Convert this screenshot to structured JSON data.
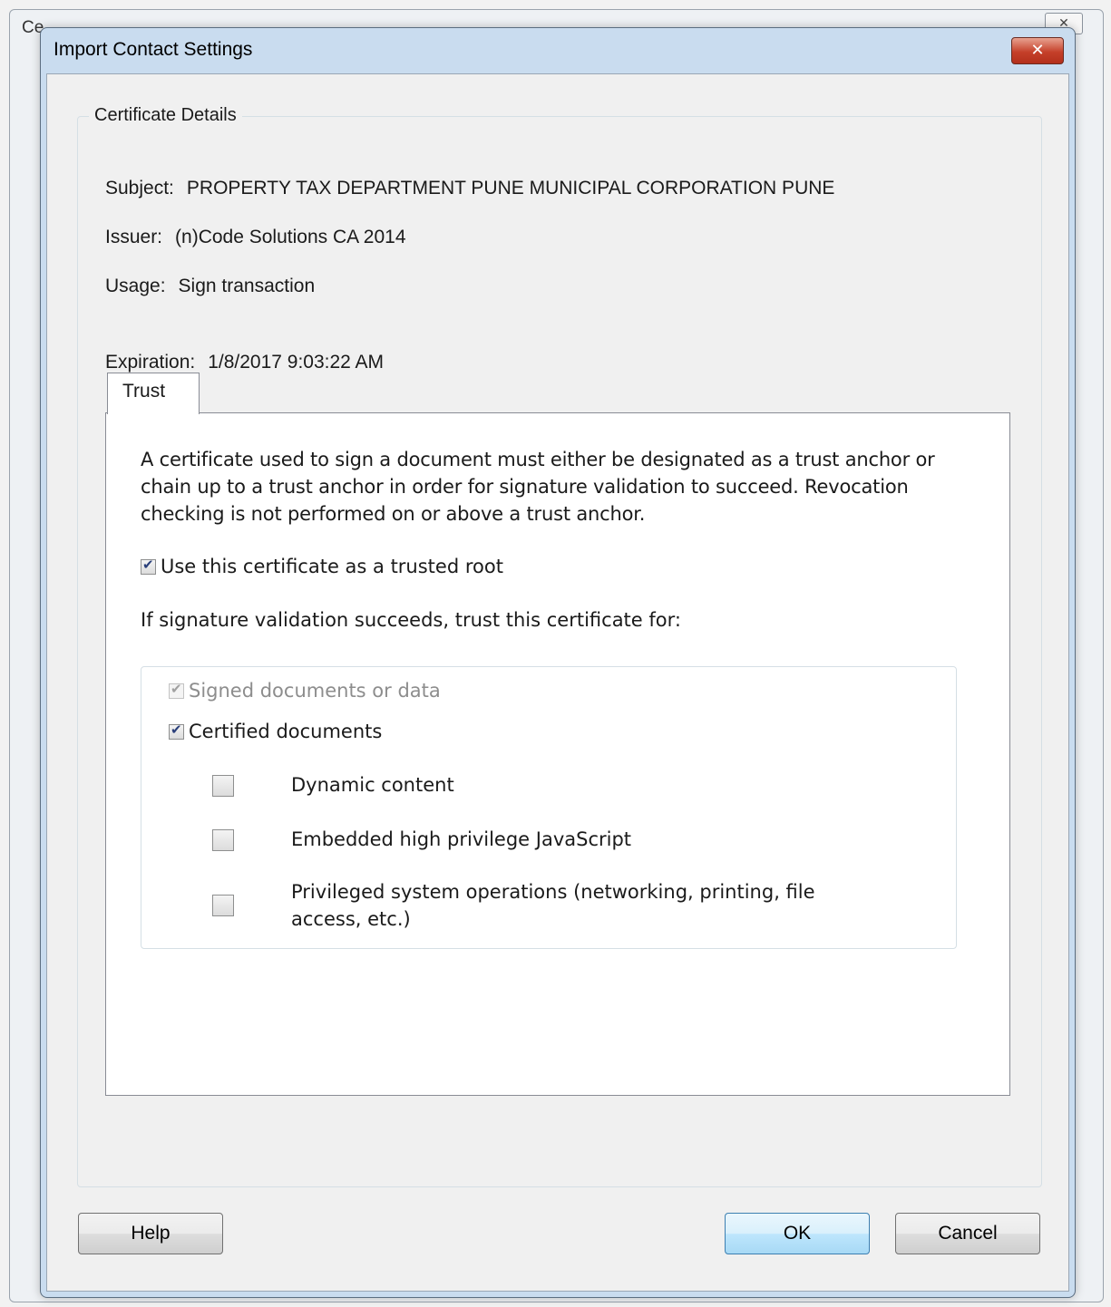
{
  "background_window": {
    "title": "Ce",
    "close_label": "✕"
  },
  "dialog": {
    "title": "Import Contact Settings",
    "close_label": "✕"
  },
  "certificate": {
    "group_title": "Certificate Details",
    "subject_label": "Subject:",
    "subject_value": "PROPERTY TAX DEPARTMENT PUNE MUNICIPAL CORPORATION PUNE",
    "issuer_label": "Issuer:",
    "issuer_value": "(n)Code Solutions CA 2014",
    "usage_label": "Usage:",
    "usage_value": "Sign transaction",
    "expiration_label": "Expiration:",
    "expiration_value": "1/8/2017 9:03:22 AM"
  },
  "trust_tab": {
    "tab_label": "Trust",
    "description": "A certificate used to sign a document must either be designated as a trust anchor or chain up to a trust anchor in order for signature validation to succeed.  Revocation checking is not performed on or above a trust anchor.",
    "trusted_root_label": "Use this certificate as a trusted root",
    "trusted_root_checked": true,
    "trust_for_label": "If signature validation succeeds, trust this certificate for:",
    "signed_docs_label": "Signed documents or data",
    "signed_docs_checked": true,
    "certified_docs_label": "Certified documents",
    "certified_docs_checked": true,
    "dynamic_content_label": "Dynamic content",
    "dynamic_content_checked": false,
    "javascript_label": "Embedded high privilege JavaScript",
    "javascript_checked": false,
    "system_ops_label": "Privileged system operations (networking, printing, file access, etc.)",
    "system_ops_checked": false
  },
  "buttons": {
    "help": "Help",
    "ok": "OK",
    "cancel": "Cancel"
  },
  "colors": {
    "dialog_frame": "#c9dcef",
    "close_button": "#c5402a",
    "default_button": "#a7d9f5"
  }
}
